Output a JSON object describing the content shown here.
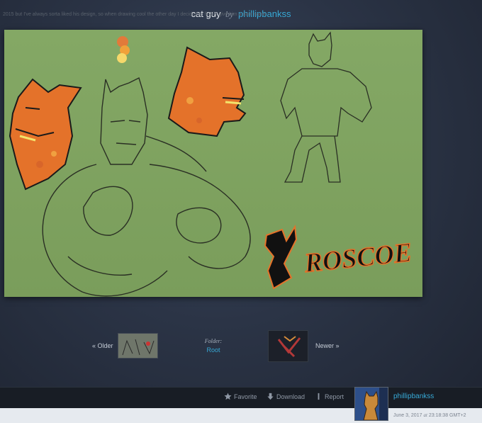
{
  "deviation": {
    "title": "cat guy",
    "by_word": "by",
    "author": "phillipbankss"
  },
  "artwork": {
    "lettering": "ROSCOE"
  },
  "navigation": {
    "older_label": "« Older",
    "folder_label": "Folder:",
    "folder_value": "Root",
    "newer_label": "Newer »"
  },
  "actions": {
    "favorite": "Favorite",
    "download": "Download",
    "report": "Report"
  },
  "artist": {
    "username": "phillipbankss",
    "date": "June 3, 2017",
    "at_word": "at",
    "time": "23:18:38 GMT+2"
  },
  "description": {
    "text": "2015 but I've always sorta liked his design, so when drawing cool the other day I decided to finally give him a dam name"
  },
  "colors": {
    "accent": "#37a9d6",
    "art_background": "#7fa360",
    "fur_orange": "#e4722a",
    "bottom_bar": "#181d25"
  },
  "icons": [
    "star-icon",
    "download-arrow-icon",
    "report-flag-icon"
  ]
}
